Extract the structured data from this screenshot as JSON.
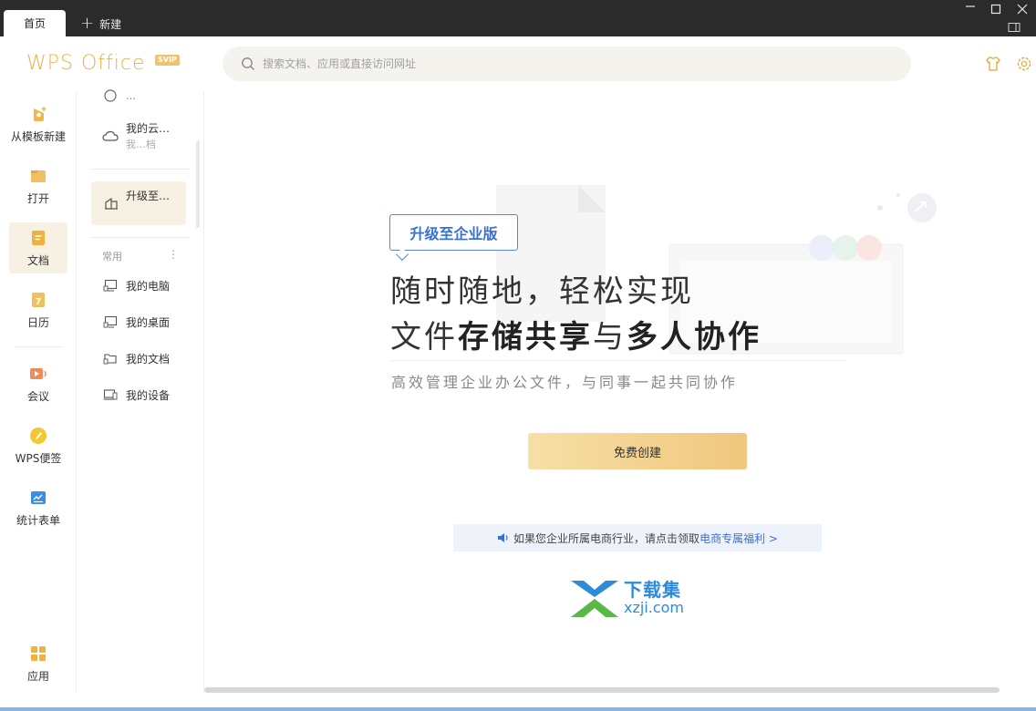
{
  "titlebar": {
    "tab_home": "首页",
    "tab_new": "新建"
  },
  "header": {
    "logo": "WPS Office",
    "badge": "SVIP",
    "search_placeholder": "搜索文档、应用或直接访问网址"
  },
  "leftnav": {
    "items": [
      {
        "label": "从模板新建",
        "icon": "template-new-icon"
      },
      {
        "label": "打开",
        "icon": "folder-open-icon"
      },
      {
        "label": "文档",
        "icon": "document-icon"
      },
      {
        "label": "日历",
        "icon": "calendar-icon"
      },
      {
        "label": "会议",
        "icon": "meeting-icon"
      },
      {
        "label": "WPS便签",
        "icon": "note-icon"
      },
      {
        "label": "统计表单",
        "icon": "form-icon"
      },
      {
        "label": "应用",
        "icon": "apps-grid-icon"
      }
    ],
    "active": "文档"
  },
  "panel": {
    "partial_top": "…",
    "cloud_title": "我的云…",
    "cloud_sub": "我…档",
    "upgrade": "升级至…",
    "section": "常用",
    "section_more": "⋮",
    "items": [
      "我的电脑",
      "我的桌面",
      "我的文档",
      "我的设备"
    ]
  },
  "main": {
    "badge": "升级至企业版",
    "line1": "随时随地，轻松实现",
    "line2_a": "文件",
    "line2_b": "存储共享",
    "line2_c": "与",
    "line2_d": "多人协作",
    "subtitle": "高效管理企业办公文件，与同事一起共同协作",
    "cta": "免费创建",
    "notice_text": "如果您企业所属电商行业，请点击领取",
    "notice_link": "电商专属福利 >",
    "watermark_cn": "下载集",
    "watermark_en": "xzji.com"
  },
  "colors": {
    "accent_gold": "#e9b24c",
    "link_blue": "#3a6fd6",
    "titlebar": "#2b2b2b"
  }
}
